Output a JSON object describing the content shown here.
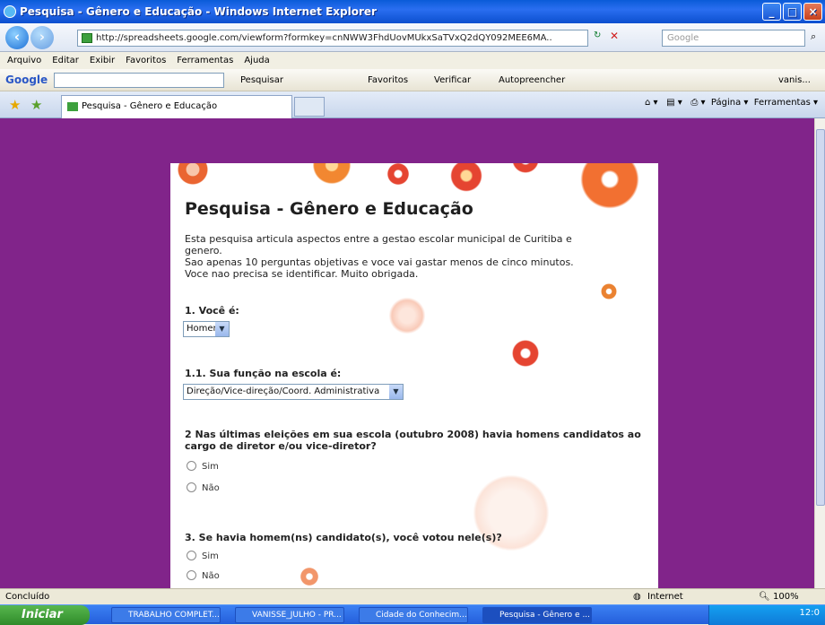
{
  "window": {
    "title": "Pesquisa - Gênero e Educação - Windows Internet Explorer"
  },
  "address": {
    "url": "http://spreadsheets.google.com/viewform?formkey=cnNWW3FhdUovMUkxSaTVxQ2dQY092MEE6MA..",
    "search_placeholder": "Google"
  },
  "menu": [
    "Arquivo",
    "Editar",
    "Exibir",
    "Favoritos",
    "Ferramentas",
    "Ajuda"
  ],
  "googlebar": {
    "logo": "Google",
    "items": [
      "Pesquisar",
      "Favoritos",
      "Verificar",
      "Autopreencher",
      "vanis..."
    ]
  },
  "tab": {
    "label": "Pesquisa - Gênero e Educação"
  },
  "tools": {
    "page": "Página",
    "tools": "Ferramentas"
  },
  "form": {
    "title": "Pesquisa - Gênero e Educação",
    "desc_line1": "Esta pesquisa articula aspectos entre a gestao escolar municipal de Curitiba e",
    "desc_line2": "genero.",
    "desc_line3": "Sao apenas 10 perguntas objetivas e voce vai gastar menos de cinco minutos.",
    "desc_line4": "Voce nao precisa se identificar. Muito obrigada.",
    "q1": "1. Você é:",
    "q1_value": "Homem",
    "q11": "1.1. Sua função na escola é:",
    "q11_value": "Direção/Vice-direção/Coord. Administrativa",
    "q2": "2 Nas últimas eleições em sua escola (outubro 2008) havia homens candidatos ao cargo de diretor e/ou vice-diretor?",
    "q2_opt1": "Sim",
    "q2_opt2": "Não",
    "q3": "3. Se havia homem(ns) candidato(s), você votou nele(s)?",
    "q3_opt1": "Sim",
    "q3_opt2": "Não"
  },
  "status": {
    "left": "Concluído",
    "zone": "Internet",
    "zoom": "100%"
  },
  "taskbar": {
    "start": "Iniciar",
    "tasks": [
      "TRABALHO COMPLET...",
      "VANISSE_JULHO - PR...",
      "Cidade do Conhecim...",
      "Pesquisa - Gênero e ..."
    ],
    "clock": "12:0"
  }
}
